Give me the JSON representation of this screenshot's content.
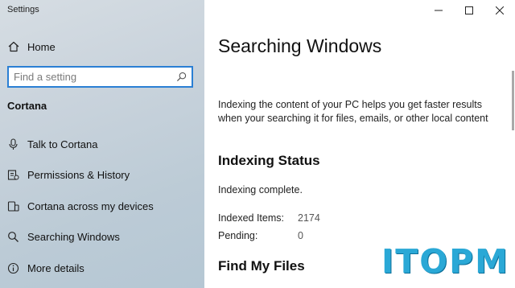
{
  "window": {
    "title": "Settings"
  },
  "sidebar": {
    "home_label": "Home",
    "search": {
      "placeholder": "Find a setting",
      "value": ""
    },
    "section_heading": "Cortana",
    "items": [
      {
        "label": "Talk to Cortana",
        "icon": "microphone-icon"
      },
      {
        "label": "Permissions & History",
        "icon": "permissions-icon"
      },
      {
        "label": "Cortana across my devices",
        "icon": "devices-icon"
      },
      {
        "label": "Searching Windows",
        "icon": "search-icon"
      },
      {
        "label": "More details",
        "icon": "info-icon"
      }
    ]
  },
  "main": {
    "title": "Searching Windows",
    "description": "Indexing the content of your PC helps you get faster results when your searching it for files, emails, or other local content",
    "indexing_status": {
      "heading": "Indexing Status",
      "status": "Indexing complete.",
      "indexed_items_label": "Indexed Items:",
      "indexed_items_value": "2174",
      "pending_label": "Pending:",
      "pending_value": "0"
    },
    "find_my_files_heading": "Find My Files"
  },
  "watermark": "ITOPM",
  "colors": {
    "search_border": "#2a7fd4",
    "watermark": "#2aa8d6"
  }
}
